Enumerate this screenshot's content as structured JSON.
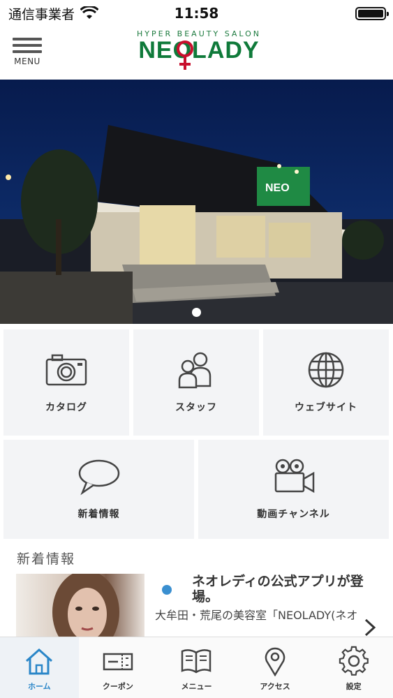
{
  "status_bar": {
    "carrier": "通信事業者",
    "time": "11:58"
  },
  "header": {
    "menu_label": "MENU",
    "logo_sub": "HYPER BEAUTY SALON",
    "logo_main": "NEOLADY",
    "logo_color": "#0f7a3a",
    "logo_accent": "#c8102e"
  },
  "hero": {
    "carousel_pages": 1,
    "current_page": 1
  },
  "grid": {
    "tiles": [
      {
        "label": "カタログ",
        "icon": "camera-icon"
      },
      {
        "label": "スタッフ",
        "icon": "people-icon"
      },
      {
        "label": "ウェブサイト",
        "icon": "globe-icon"
      },
      {
        "label": "新着情報",
        "icon": "speech-bubble-icon"
      },
      {
        "label": "動画チャンネル",
        "icon": "video-camera-icon"
      }
    ]
  },
  "news": {
    "section_title": "新着情報",
    "items": [
      {
        "headline": "ネオレディの公式アプリが登場。",
        "body": "大牟田・荒尾の美容室「NEOLADY(ネオレディ)」の公",
        "indicator_color": "#3a8fd0"
      }
    ]
  },
  "tabbar": {
    "accent": "#2a86c8",
    "tabs": [
      {
        "label": "ホーム",
        "icon": "home-icon",
        "active": true
      },
      {
        "label": "クーポン",
        "icon": "coupon-icon",
        "active": false
      },
      {
        "label": "メニュー",
        "icon": "book-icon",
        "active": false
      },
      {
        "label": "アクセス",
        "icon": "map-pin-icon",
        "active": false
      },
      {
        "label": "設定",
        "icon": "gear-icon",
        "active": false
      }
    ]
  }
}
